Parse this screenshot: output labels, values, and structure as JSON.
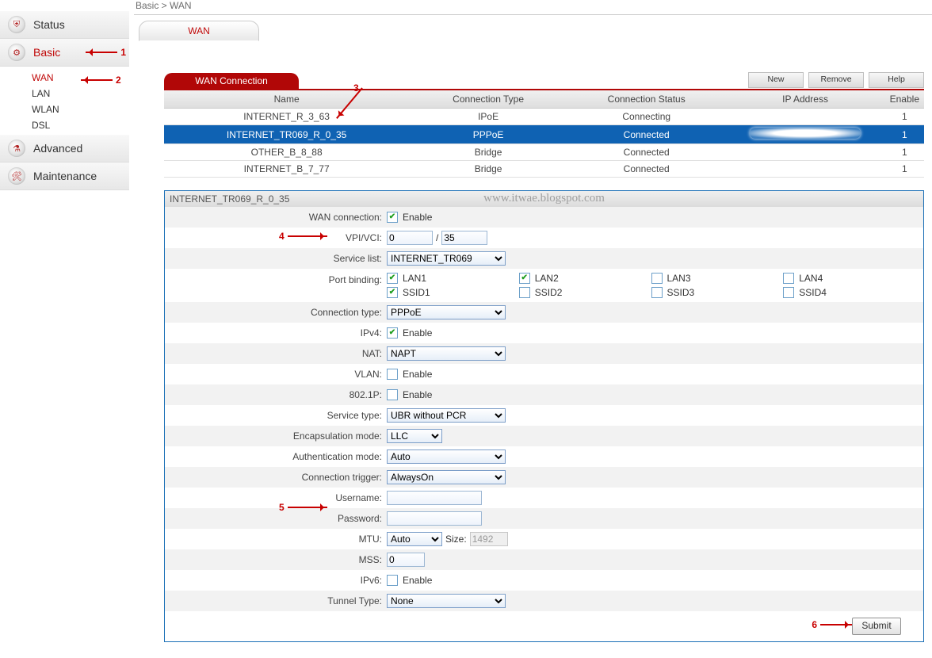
{
  "breadcrumb": "Basic > WAN",
  "sidebar": {
    "items": [
      {
        "label": "Status"
      },
      {
        "label": "Basic",
        "accent": true
      },
      {
        "label": "Advanced"
      },
      {
        "label": "Maintenance"
      }
    ],
    "basic_sub": [
      {
        "label": "WAN",
        "accent": true
      },
      {
        "label": "LAN"
      },
      {
        "label": "WLAN"
      },
      {
        "label": "DSL"
      }
    ]
  },
  "tab": {
    "wan": "WAN"
  },
  "section": {
    "title": "WAN Connection"
  },
  "actions": {
    "new": "New",
    "remove": "Remove",
    "help": "Help"
  },
  "table": {
    "headers": {
      "name": "Name",
      "ctype": "Connection Type",
      "cstatus": "Connection Status",
      "ip": "IP Address",
      "enable": "Enable"
    },
    "rows": [
      {
        "name": "INTERNET_R_3_63",
        "ctype": "IPoE",
        "cstatus": "Connecting",
        "ip": "",
        "enable": "1"
      },
      {
        "name": "INTERNET_TR069_R_0_35",
        "ctype": "PPPoE",
        "cstatus": "Connected",
        "ip": "(hidden)",
        "enable": "1"
      },
      {
        "name": "OTHER_B_8_88",
        "ctype": "Bridge",
        "cstatus": "Connected",
        "ip": "",
        "enable": "1"
      },
      {
        "name": "INTERNET_B_7_77",
        "ctype": "Bridge",
        "cstatus": "Connected",
        "ip": "",
        "enable": "1"
      }
    ]
  },
  "detail": {
    "title": "INTERNET_TR069_R_0_35",
    "watermark": "www.itwae.blogspot.com",
    "labels": {
      "wan_conn": "WAN connection:",
      "vpi_vci": "VPI/VCI:",
      "vpi": "0",
      "vci": "35",
      "vpi_sep": "/",
      "service_list": "Service list:",
      "service_list_val": "INTERNET_TR069",
      "port_binding": "Port binding:",
      "conn_type": "Connection type:",
      "conn_type_val": "PPPoE",
      "ipv4": "IPv4:",
      "nat": "NAT:",
      "nat_val": "NAPT",
      "vlan": "VLAN:",
      "p8021": "802.1P:",
      "service_type": "Service type:",
      "service_type_val": "UBR without PCR",
      "encap": "Encapsulation mode:",
      "encap_val": "LLC",
      "auth": "Authentication mode:",
      "auth_val": "Auto",
      "trigger": "Connection trigger:",
      "trigger_val": "AlwaysOn",
      "username": "Username:",
      "username_val": "",
      "password": "Password:",
      "password_val": "",
      "mtu": "MTU:",
      "mtu_val": "Auto",
      "mtu_size_label": "Size:",
      "mtu_size": "1492",
      "mss": "MSS:",
      "mss_val": "0",
      "ipv6": "IPv6:",
      "tunnel": "Tunnel Type:",
      "tunnel_val": "None",
      "enable": " Enable"
    },
    "ports": {
      "lan1": "LAN1",
      "lan2": "LAN2",
      "lan3": "LAN3",
      "lan4": "LAN4",
      "ssid1": "SSID1",
      "ssid2": "SSID2",
      "ssid3": "SSID3",
      "ssid4": "SSID4"
    },
    "submit": "Submit"
  },
  "annotations": {
    "n1": "1",
    "n2": "2",
    "n3": "3",
    "n4": "4",
    "n5": "5",
    "n6": "6"
  }
}
